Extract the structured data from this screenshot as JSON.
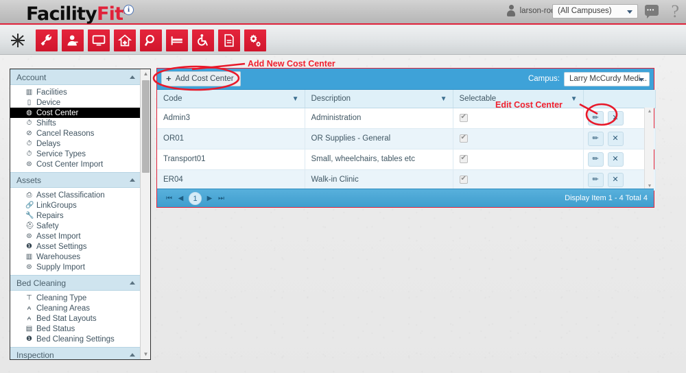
{
  "brand": {
    "name_part1": "Facility",
    "name_part2": "Fit",
    "trademark": "®",
    "info_icon": "info-icon"
  },
  "header": {
    "user": "larson-rodger",
    "user_caret": "chevron-down-icon",
    "campus_filter": "(All Campuses)",
    "chat_icon": "chat-icon",
    "help_icon": "question-mark-icon"
  },
  "toolbar": {
    "items": [
      {
        "name": "burst-icon",
        "glyph": "✳"
      },
      {
        "name": "wrench-icon",
        "glyph": "ὒ7"
      },
      {
        "name": "user-admin-icon",
        "glyph": "὆4"
      },
      {
        "name": "monitor-icon",
        "glyph": "Ὓ5"
      },
      {
        "name": "hospital-home-icon",
        "glyph": "⌂"
      },
      {
        "name": "search-icon",
        "glyph": "ὐD"
      },
      {
        "name": "bed-icon",
        "glyph": "ὬF"
      },
      {
        "name": "wheelchair-icon",
        "glyph": "♿"
      },
      {
        "name": "document-icon",
        "glyph": "Ὄ4"
      },
      {
        "name": "settings-gears-icon",
        "glyph": "⚙"
      }
    ]
  },
  "sidebar": {
    "groups": [
      {
        "label": "Account",
        "collapse_icon": "chevron-up-icon",
        "items": [
          {
            "label": "Facilities",
            "icon": "building-icon",
            "selected": false
          },
          {
            "label": "Device",
            "icon": "device-icon",
            "selected": false
          },
          {
            "label": "Cost Center",
            "icon": "clock-icon",
            "selected": true
          },
          {
            "label": "Shifts",
            "icon": "timer-icon",
            "selected": false
          },
          {
            "label": "Cancel Reasons",
            "icon": "no-entry-icon",
            "selected": false
          },
          {
            "label": "Delays",
            "icon": "timer-icon",
            "selected": false
          },
          {
            "label": "Service Types",
            "icon": "timer-icon",
            "selected": false
          },
          {
            "label": "Cost Center Import",
            "icon": "layers-icon",
            "selected": false
          }
        ]
      },
      {
        "label": "Assets",
        "collapse_icon": "chevron-up-icon",
        "items": [
          {
            "label": "Asset Classification",
            "icon": "printer-icon",
            "selected": false
          },
          {
            "label": "LinkGroups",
            "icon": "link-icon",
            "selected": false
          },
          {
            "label": "Repairs",
            "icon": "wrench-icon",
            "selected": false
          },
          {
            "label": "Safety",
            "icon": "safety-icon",
            "selected": false
          },
          {
            "label": "Asset Import",
            "icon": "layers-icon",
            "selected": false
          },
          {
            "label": "Asset Settings",
            "icon": "help-circle-icon",
            "selected": false
          },
          {
            "label": "Warehouses",
            "icon": "building-icon",
            "selected": false
          },
          {
            "label": "Supply Import",
            "icon": "layers-icon",
            "selected": false
          }
        ]
      },
      {
        "label": "Bed Cleaning",
        "collapse_icon": "chevron-up-icon",
        "items": [
          {
            "label": "Cleaning Type",
            "icon": "mop-icon",
            "selected": false
          },
          {
            "label": "Cleaning Areas",
            "icon": "hierarchy-icon",
            "selected": false
          },
          {
            "label": "Bed Stat Layouts",
            "icon": "hierarchy-icon",
            "selected": false
          },
          {
            "label": "Bed Status",
            "icon": "list-icon",
            "selected": false
          },
          {
            "label": "Bed Cleaning Settings",
            "icon": "help-circle-icon",
            "selected": false
          }
        ]
      },
      {
        "label": "Inspection",
        "collapse_icon": "chevron-up-icon",
        "items": []
      }
    ],
    "scrollbar": {
      "up_arrow": "scroll-up-arrow",
      "down_arrow": "scroll-down-arrow"
    }
  },
  "grid": {
    "add_button": "Add Cost Center",
    "add_button_plus": "+",
    "campus_label": "Campus:",
    "campus_value": "Larry McCurdy Medi...",
    "columns": [
      {
        "label": "Code",
        "filter": true
      },
      {
        "label": "Description",
        "filter": true
      },
      {
        "label": "Selectable",
        "filter": true
      },
      {
        "label": "",
        "filter": false
      }
    ],
    "rows": [
      {
        "code": "Admin3",
        "description": "Administration",
        "selectable": true,
        "edit": "edit-icon",
        "delete": "delete-icon"
      },
      {
        "code": "OR01",
        "description": "OR Supplies - General",
        "selectable": true,
        "edit": "edit-icon",
        "delete": "delete-icon"
      },
      {
        "code": "Transport01",
        "description": "Small, wheelchairs, tables etc",
        "selectable": true,
        "edit": "edit-icon",
        "delete": "delete-icon"
      },
      {
        "code": "ER04",
        "description": "Walk-in Clinic",
        "selectable": true,
        "edit": "edit-icon",
        "delete": "delete-icon"
      }
    ],
    "pager": {
      "first": "⏮",
      "prev": "◀",
      "current_page": "1",
      "next": "▶",
      "last": "⏭",
      "info": "Display Item 1 - 4 Total 4"
    }
  },
  "annotations": [
    {
      "name": "annotation-add-new-cost-center",
      "text": "Add New Cost Center"
    },
    {
      "name": "annotation-edit-cost-center",
      "text": "Edit Cost Center"
    }
  ],
  "colors": {
    "brand_red": "#e0223a",
    "annotation_red": "#f1202e",
    "grid_blue": "#3ea2d8",
    "header_blue": "#dff0f8",
    "selected_black": "#000000"
  }
}
